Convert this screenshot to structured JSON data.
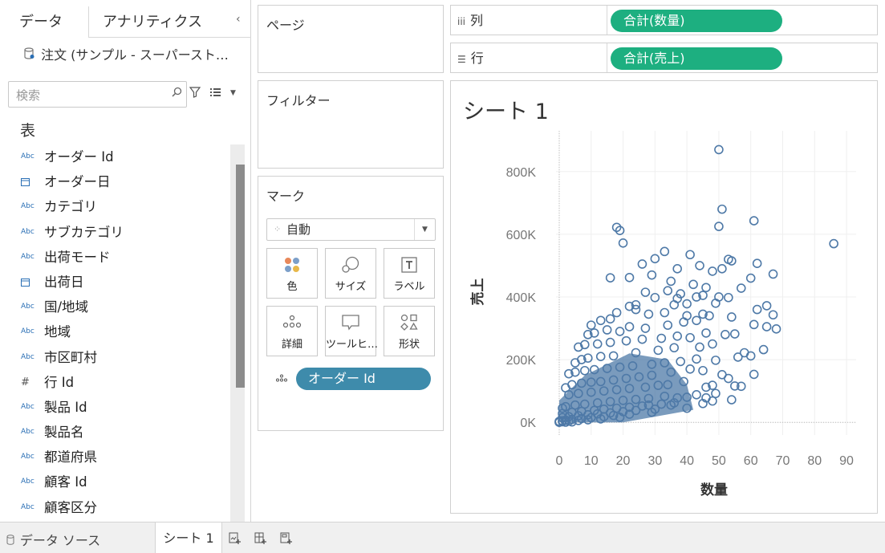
{
  "left_pane": {
    "tab_data": "データ",
    "tab_analytics": "アナリティクス",
    "collapse_glyph": "‹",
    "data_source": "注文 (サンプル - スーパースト…",
    "search_placeholder": "検索",
    "section_title": "表",
    "fields": [
      {
        "type": "Abc",
        "name": "オーダー Id"
      },
      {
        "type": "date",
        "name": "オーダー日"
      },
      {
        "type": "Abc",
        "name": "カテゴリ"
      },
      {
        "type": "Abc",
        "name": "サブカテゴリ"
      },
      {
        "type": "Abc",
        "name": "出荷モード"
      },
      {
        "type": "date",
        "name": "出荷日"
      },
      {
        "type": "Abc",
        "name": "国/地域"
      },
      {
        "type": "Abc",
        "name": "地域"
      },
      {
        "type": "Abc",
        "name": "市区町村"
      },
      {
        "type": "#",
        "name": "行 Id"
      },
      {
        "type": "Abc",
        "name": "製品 Id"
      },
      {
        "type": "Abc",
        "name": "製品名"
      },
      {
        "type": "Abc",
        "name": "都道府県"
      },
      {
        "type": "Abc",
        "name": "顧客 Id"
      },
      {
        "type": "Abc",
        "name": "顧客区分"
      }
    ]
  },
  "cards": {
    "pages": "ページ",
    "filters": "フィルター",
    "marks": "マーク",
    "mark_type": "自動",
    "buttons": {
      "color": "色",
      "size": "サイズ",
      "label": "ラベル",
      "detail": "詳細",
      "tooltip": "ツールヒ…",
      "shape": "形状"
    },
    "detail_pill": "オーダー Id"
  },
  "shelves": {
    "columns_label": "列",
    "columns_pill": "合計(数量)",
    "rows_label": "行",
    "rows_pill": "合計(売上)"
  },
  "sheet_title": "シート 1",
  "colors": {
    "measure_pill": "#1daf80",
    "dimension_pill": "#3e8bab",
    "mark": "#4e79a7"
  },
  "chart_data": {
    "type": "scatter",
    "xlabel": "数量",
    "ylabel": "売上",
    "xlim": [
      -1,
      93
    ],
    "ylim": [
      -20000,
      930000
    ],
    "x_ticks": [
      0,
      10,
      20,
      30,
      40,
      50,
      60,
      70,
      80,
      90
    ],
    "y_ticks": [
      0,
      200000,
      400000,
      600000,
      800000
    ],
    "y_tick_labels": [
      "0K",
      "200K",
      "400K",
      "600K",
      "800K"
    ],
    "grid": true,
    "mark_shape": "open-circle",
    "points": [
      [
        50,
        870000
      ],
      [
        86,
        570000
      ],
      [
        51,
        680000
      ],
      [
        61,
        643000
      ],
      [
        50,
        625000
      ],
      [
        18,
        622000
      ],
      [
        19,
        612000
      ],
      [
        20,
        572000
      ],
      [
        33,
        545000
      ],
      [
        41,
        535000
      ],
      [
        30,
        522000
      ],
      [
        53,
        520000
      ],
      [
        54,
        515000
      ],
      [
        62,
        507000
      ],
      [
        44,
        500000
      ],
      [
        26,
        505000
      ],
      [
        37,
        490000
      ],
      [
        48,
        482000
      ],
      [
        51,
        490000
      ],
      [
        67,
        473000
      ],
      [
        60,
        460000
      ],
      [
        29,
        470000
      ],
      [
        22,
        462000
      ],
      [
        16,
        461000
      ],
      [
        35,
        450000
      ],
      [
        42,
        440000
      ],
      [
        46,
        430000
      ],
      [
        57,
        428000
      ],
      [
        34,
        420000
      ],
      [
        27,
        415000
      ],
      [
        38,
        410000
      ],
      [
        43,
        400000
      ],
      [
        53,
        398000
      ],
      [
        30,
        398000
      ],
      [
        45,
        405000
      ],
      [
        65,
        372000
      ],
      [
        62,
        360000
      ],
      [
        22,
        370000
      ],
      [
        24,
        375000
      ],
      [
        36,
        375000
      ],
      [
        40,
        378000
      ],
      [
        49,
        380000
      ],
      [
        37,
        395000
      ],
      [
        50,
        400000
      ],
      [
        67,
        343000
      ],
      [
        54,
        336000
      ],
      [
        47,
        340000
      ],
      [
        45,
        345000
      ],
      [
        40,
        340000
      ],
      [
        33,
        350000
      ],
      [
        28,
        345000
      ],
      [
        24,
        360000
      ],
      [
        18,
        350000
      ],
      [
        16,
        330000
      ],
      [
        13,
        325000
      ],
      [
        10,
        310000
      ],
      [
        61,
        312000
      ],
      [
        65,
        305000
      ],
      [
        68,
        298000
      ],
      [
        43,
        325000
      ],
      [
        39,
        320000
      ],
      [
        34,
        310000
      ],
      [
        27,
        300000
      ],
      [
        22,
        305000
      ],
      [
        19,
        290000
      ],
      [
        15,
        295000
      ],
      [
        11,
        285000
      ],
      [
        9,
        280000
      ],
      [
        55,
        282000
      ],
      [
        52,
        280000
      ],
      [
        46,
        285000
      ],
      [
        41,
        270000
      ],
      [
        37,
        275000
      ],
      [
        32,
        268000
      ],
      [
        26,
        265000
      ],
      [
        21,
        260000
      ],
      [
        16,
        255000
      ],
      [
        12,
        250000
      ],
      [
        8,
        248000
      ],
      [
        6,
        240000
      ],
      [
        64,
        232000
      ],
      [
        58,
        222000
      ],
      [
        48,
        250000
      ],
      [
        44,
        240000
      ],
      [
        36,
        238000
      ],
      [
        31,
        230000
      ],
      [
        24,
        222000
      ],
      [
        17,
        212000
      ],
      [
        13,
        210000
      ],
      [
        9,
        205000
      ],
      [
        7,
        200000
      ],
      [
        5,
        190000
      ],
      [
        60,
        212000
      ],
      [
        56,
        208000
      ],
      [
        49,
        198000
      ],
      [
        43,
        202000
      ],
      [
        38,
        194000
      ],
      [
        33,
        190000
      ],
      [
        29,
        185000
      ],
      [
        23,
        180000
      ],
      [
        19,
        176000
      ],
      [
        15,
        172000
      ],
      [
        11,
        168000
      ],
      [
        8,
        165000
      ],
      [
        5,
        160000
      ],
      [
        3,
        155000
      ],
      [
        61,
        153000
      ],
      [
        51,
        152000
      ],
      [
        45,
        165000
      ],
      [
        41,
        170000
      ],
      [
        35,
        160000
      ],
      [
        29,
        150000
      ],
      [
        25,
        145000
      ],
      [
        21,
        140000
      ],
      [
        17,
        135000
      ],
      [
        13,
        130000
      ],
      [
        10,
        128000
      ],
      [
        7,
        125000
      ],
      [
        4,
        120000
      ],
      [
        2,
        110000
      ],
      [
        57,
        115000
      ],
      [
        55,
        116000
      ],
      [
        48,
        118000
      ],
      [
        46,
        112000
      ],
      [
        53,
        140000
      ],
      [
        39,
        130000
      ],
      [
        34,
        120000
      ],
      [
        31,
        118000
      ],
      [
        27,
        112000
      ],
      [
        22,
        108000
      ],
      [
        18,
        104000
      ],
      [
        14,
        100000
      ],
      [
        10,
        96000
      ],
      [
        6,
        92000
      ],
      [
        3,
        88000
      ],
      [
        49,
        92000
      ],
      [
        43,
        88000
      ],
      [
        40,
        80000
      ],
      [
        37,
        78000
      ],
      [
        33,
        83000
      ],
      [
        28,
        76000
      ],
      [
        24,
        73000
      ],
      [
        20,
        70000
      ],
      [
        16,
        66000
      ],
      [
        12,
        62000
      ],
      [
        8,
        58000
      ],
      [
        5,
        55000
      ],
      [
        2,
        50000
      ],
      [
        1,
        45000
      ],
      [
        54,
        72000
      ],
      [
        48,
        68000
      ],
      [
        46,
        78000
      ],
      [
        36,
        62000
      ],
      [
        32,
        58000
      ],
      [
        28,
        55000
      ],
      [
        45,
        60000
      ],
      [
        35,
        55000
      ],
      [
        26,
        52000
      ],
      [
        22,
        48000
      ],
      [
        18,
        45000
      ],
      [
        14,
        42000
      ],
      [
        11,
        38000
      ],
      [
        7,
        35000
      ],
      [
        4,
        32000
      ],
      [
        1,
        28000
      ],
      [
        40,
        45000
      ],
      [
        30,
        42000
      ],
      [
        24,
        38000
      ],
      [
        20,
        34000
      ],
      [
        16,
        30000
      ],
      [
        12,
        27000
      ],
      [
        9,
        24000
      ],
      [
        6,
        21000
      ],
      [
        3,
        18000
      ],
      [
        1,
        15000
      ],
      [
        29,
        32000
      ],
      [
        22,
        26000
      ],
      [
        17,
        22000
      ],
      [
        14,
        18000
      ],
      [
        10,
        15000
      ],
      [
        7,
        12000
      ],
      [
        4,
        9000
      ],
      [
        2,
        7000
      ],
      [
        1,
        5000
      ],
      [
        0,
        3000
      ],
      [
        19,
        16000
      ],
      [
        13,
        11000
      ],
      [
        9,
        8000
      ],
      [
        6,
        6000
      ],
      [
        3,
        4000
      ],
      [
        1,
        2000
      ],
      [
        0,
        1000
      ],
      [
        0,
        0
      ],
      [
        2,
        500
      ],
      [
        4,
        1500
      ]
    ]
  }
}
